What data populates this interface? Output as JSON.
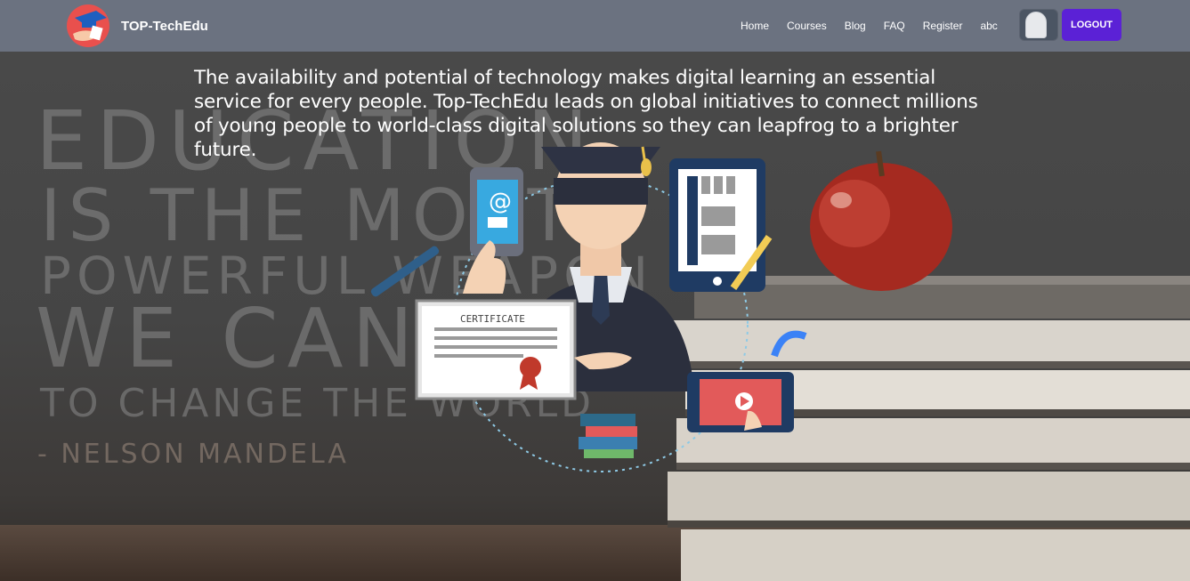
{
  "brand": {
    "name": "TOP-TechEdu"
  },
  "nav": {
    "links": [
      "Home",
      "Courses",
      "Blog",
      "FAQ",
      "Register",
      "abc"
    ],
    "logout_label": "LOGOUT"
  },
  "hero": {
    "intro_text": "The availability and potential of technology makes digital learning an essential service for every people. Top-TechEdu leads on global initiatives to connect millions of young people to world-class digital solutions so they can leapfrog to a brighter future.",
    "chalk_lines": [
      "EDUCATION",
      "IS THE MOST",
      "POWERFUL WEAPON",
      "WE CAN USE",
      "TO CHANGE THE WORLD",
      "- NELSON MANDELA"
    ],
    "certificate_label": "CERTIFICATE",
    "email_symbol": "@"
  },
  "colors": {
    "navbar": "#6b7280",
    "logout": "#5b21d6",
    "text": "#ffffff"
  }
}
